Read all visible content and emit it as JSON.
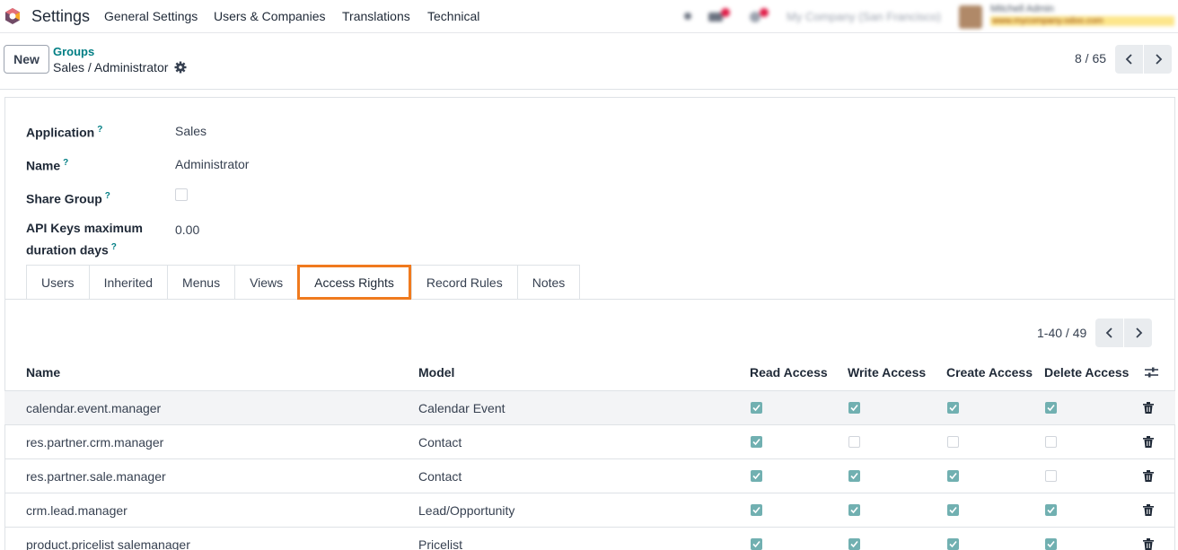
{
  "navbar": {
    "app_name": "Settings",
    "menu": [
      "General Settings",
      "Users & Companies",
      "Translations",
      "Technical"
    ],
    "company": "My Company (San Francisco)",
    "user_name": "Mitchell Admin",
    "user_db": "www.mycompany.odoo.com"
  },
  "control_panel": {
    "new_label": "New",
    "breadcrumb_parent": "Groups",
    "breadcrumb_current": "Sales / Administrator",
    "pager": "8 / 65"
  },
  "form": {
    "application_label": "Application",
    "application_value": "Sales",
    "name_label": "Name",
    "name_value": "Administrator",
    "share_label": "Share Group",
    "share_checked": false,
    "api_label_1": "API Keys maximum",
    "api_label_2": "duration days",
    "api_value": "0.00",
    "help_mark": "?"
  },
  "tabs": [
    "Users",
    "Inherited",
    "Menus",
    "Views",
    "Access Rights",
    "Record Rules",
    "Notes"
  ],
  "active_tab": "Access Rights",
  "list": {
    "pager": "1-40 / 49",
    "columns": [
      "Name",
      "Model",
      "Read Access",
      "Write Access",
      "Create Access",
      "Delete Access"
    ],
    "rows": [
      {
        "name": "calendar.event.manager",
        "model": "Calendar Event",
        "read": true,
        "write": true,
        "create": true,
        "delete": true
      },
      {
        "name": "res.partner.crm.manager",
        "model": "Contact",
        "read": true,
        "write": false,
        "create": false,
        "delete": false
      },
      {
        "name": "res.partner.sale.manager",
        "model": "Contact",
        "read": true,
        "write": true,
        "create": true,
        "delete": false
      },
      {
        "name": "crm.lead.manager",
        "model": "Lead/Opportunity",
        "read": true,
        "write": true,
        "create": true,
        "delete": true
      },
      {
        "name": "product.pricelist salemanager",
        "model": "Pricelist",
        "read": true,
        "write": true,
        "create": true,
        "delete": true
      }
    ]
  },
  "colors": {
    "accent": "#017e84",
    "brand": "#714b67",
    "active_tab_border": "#f07a1e",
    "checkbox": "#71b0b1"
  }
}
